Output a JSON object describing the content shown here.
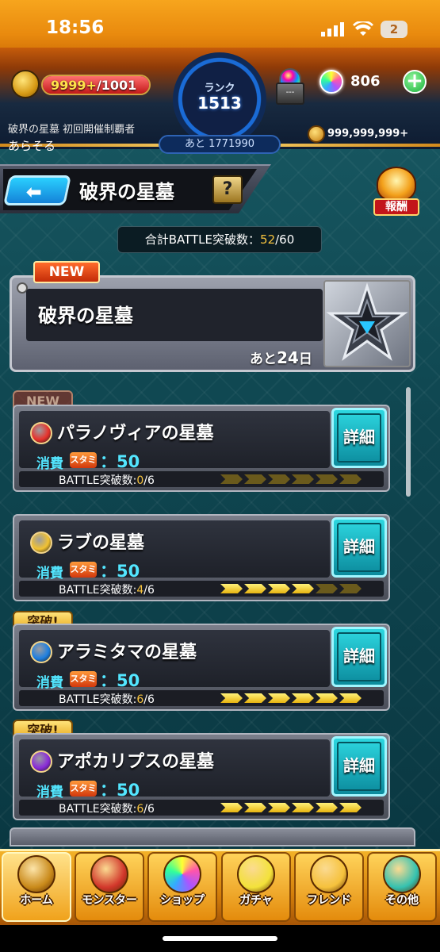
{
  "status_bar": {
    "time": "18:56",
    "battery": "2"
  },
  "header": {
    "stamina": {
      "current": "9999+",
      "max": "/1001",
      "fill": 1.0
    },
    "rank": {
      "label": "ランク",
      "value": "1513",
      "next_prefix": "あと",
      "next_value": "1771990"
    },
    "box_label": "---",
    "orbs": "806",
    "player_title": "破界の星墓 初回開催制覇者",
    "player_name": "あらそる",
    "coins": "999,999,999+"
  },
  "title_bar": {
    "title": "破界の星墓",
    "help": "?",
    "reward": "報酬"
  },
  "total": {
    "label": "合計BATTLE突破数：",
    "current": "52",
    "max": "/60"
  },
  "event": {
    "badge": "NEW",
    "title": "破界の星墓",
    "remain_prefix": "あと",
    "remain_num": "24",
    "remain_suffix": "日"
  },
  "quests": [
    {
      "flag": "NEW",
      "flag_type": "new",
      "name": "パラノヴィアの星墓",
      "element": "fire",
      "element_color": "#e8322b",
      "cost_label": "消費",
      "stamina_icon": "スタミナ",
      "cost": "：50",
      "battle_label": "BATTLE突破数:",
      "cleared": "0",
      "total": "/6",
      "progress": 0,
      "detail": "詳細"
    },
    {
      "flag": "",
      "flag_type": "",
      "name": "ラブの星墓",
      "element": "light",
      "element_color": "#f2c231",
      "cost_label": "消費",
      "stamina_icon": "スタミナ",
      "cost": "：50",
      "battle_label": "BATTLE突破数:",
      "cleared": "4",
      "total": "/6",
      "progress": 4,
      "detail": "詳細"
    },
    {
      "flag": "突破!",
      "flag_type": "break",
      "name": "アラミタマの星墓",
      "element": "water",
      "element_color": "#1e7fe0",
      "cost_label": "消費",
      "stamina_icon": "スタミナ",
      "cost": "：50",
      "battle_label": "BATTLE突破数:",
      "cleared": "6",
      "total": "/6",
      "progress": 6,
      "detail": "詳細"
    },
    {
      "flag": "突破!",
      "flag_type": "break",
      "name": "アポカリプスの星墓",
      "element": "dark",
      "element_color": "#8a2bd8",
      "cost_label": "消費",
      "stamina_icon": "スタミナ",
      "cost": "：50",
      "battle_label": "BATTLE突破数:",
      "cleared": "6",
      "total": "/6",
      "progress": 6,
      "detail": "詳細"
    }
  ],
  "nav": [
    {
      "label": "ホーム",
      "icon": "home-icon",
      "color": "#c98a1a"
    },
    {
      "label": "モンスター",
      "icon": "monster-icon",
      "color": "#d2372b"
    },
    {
      "label": "ショップ",
      "icon": "orb-shop-icon",
      "color": "#7a5cff"
    },
    {
      "label": "ガチャ",
      "icon": "gacha-icon",
      "color": "#f3e23a"
    },
    {
      "label": "フレンド",
      "icon": "friend-icon",
      "color": "#f6c23c"
    },
    {
      "label": "その他",
      "icon": "other-icon",
      "color": "#34c2b0"
    }
  ],
  "colors": {
    "accent_cyan": "#53e6ff",
    "gold": "#f6c33e"
  }
}
